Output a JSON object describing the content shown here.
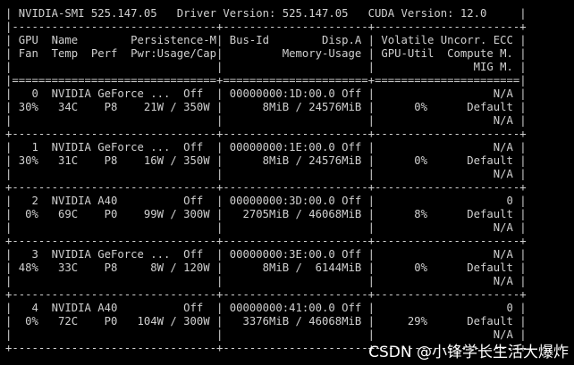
{
  "terminal": {
    "lines": [
      "| NVIDIA-SMI 525.147.05   Driver Version: 525.147.05   CUDA Version: 12.0     |",
      "|-------------------------------+----------------------+----------------------+",
      "| GPU  Name        Persistence-M| Bus-Id        Disp.A | Volatile Uncorr. ECC |",
      "| Fan  Temp  Perf  Pwr:Usage/Cap|         Memory-Usage | GPU-Util  Compute M. |",
      "|                               |                      |               MIG M. |",
      "|===============================+======================+======================|",
      "|   0  NVIDIA GeForce ...  Off  | 00000000:1D:00.0 Off |                  N/A |",
      "| 30%   34C    P8    21W / 350W |      8MiB / 24576MiB |      0%      Default |",
      "|                               |                      |                  N/A |",
      "+-------------------------------+----------------------+----------------------+",
      "|   1  NVIDIA GeForce ...  Off  | 00000000:1E:00.0 Off |                  N/A |",
      "| 30%   31C    P8    16W / 350W |      8MiB / 24576MiB |      0%      Default |",
      "|                               |                      |                  N/A |",
      "+-------------------------------+----------------------+----------------------+",
      "|   2  NVIDIA A40          Off  | 00000000:3D:00.0 Off |                    0 |",
      "|  0%   69C    P0    99W / 300W |   2705MiB / 46068MiB |      8%      Default |",
      "|                               |                      |                  N/A |",
      "+-------------------------------+----------------------+----------------------+",
      "|   3  NVIDIA GeForce ...  Off  | 00000000:3E:00.0 Off |                  N/A |",
      "| 48%   33C    P8     8W / 120W |      8MiB /  6144MiB |      0%      Default |",
      "|                               |                      |                  N/A |",
      "+-------------------------------+----------------------+----------------------+",
      "|   4  NVIDIA A40          Off  | 00000000:41:00.0 Off |                    0 |",
      "|  0%   72C    P0   104W / 300W |   3376MiB / 46068MiB |     29%      Default |",
      "|                               |                      |                  N/A |",
      "+-------------------------------+----------------------+----------------------+"
    ]
  },
  "watermark": "CSDN @小锋学长生活大爆炸"
}
